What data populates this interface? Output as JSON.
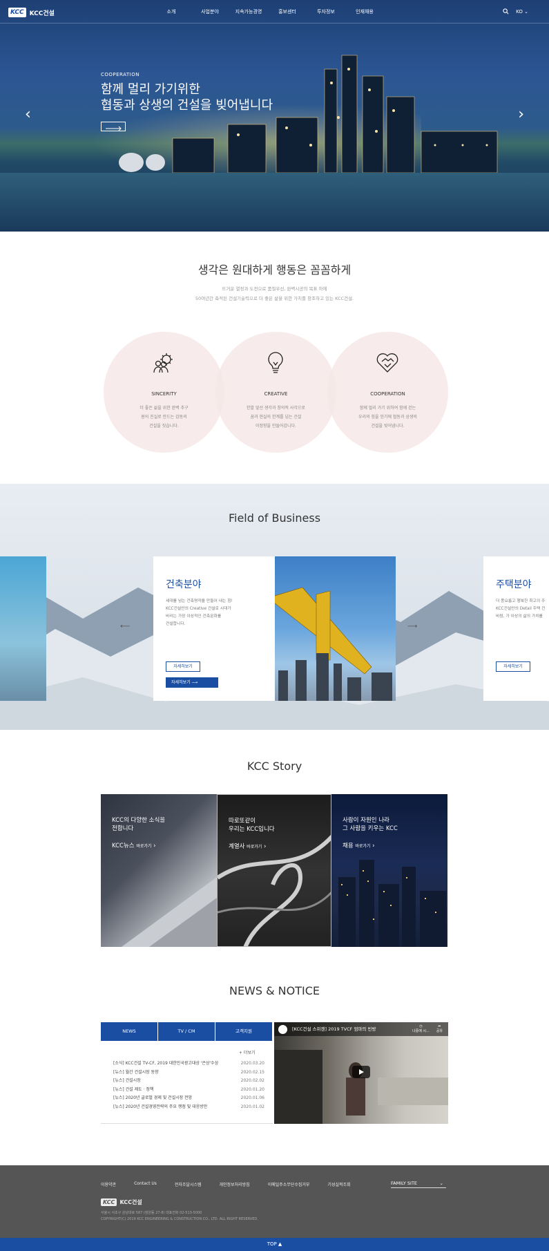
{
  "header": {
    "logo_mark": "KCC",
    "logo_text": "KCC건설",
    "nav": [
      "소개",
      "사업분야",
      "지속가능경영",
      "홍보센터",
      "투자정보",
      "인재채용"
    ],
    "lang": "KO"
  },
  "hero": {
    "eyebrow": "COOPERATION",
    "line1": "함께 멀리 가기위한",
    "line2": "협동과 상생의 건설을 빚어냅니다"
  },
  "intro": {
    "title": "생각은 원대하게 행동은 꼼꼼하게",
    "sub1": "뜨거운 열정과 도전으로 품질우선, 완벽시공의 목표 하에",
    "sub2": "50여년간 축적된 건설기술력으로 더 좋은 삶을 위한 가치를 창조하고 있는 KCC건설.",
    "values": [
      {
        "title": "SINCERITY",
        "d1": "더 좋은 삶을 위한 완벽 추구",
        "d2": "원의 진실로 만드는 감동의",
        "d3": "건설을 짓습니다."
      },
      {
        "title": "CREATIVE",
        "d1": "한발 앞선 생각과 창의적 사각으로",
        "d2": "꿈과 현실의 한계를 넘는 건설",
        "d3": "이정향을 만들어갑니다."
      },
      {
        "title": "COOPERATION",
        "d1": "함께 멀리 가기 위하여 함께 걷는",
        "d2": "우리의 힘을 믿기에 협동과 상생의",
        "d3": "건설을 빚어냅니다."
      }
    ]
  },
  "business": {
    "title": "Field of Business",
    "card1": {
      "title": "건축분야",
      "d1": "세대를 넘는 건축명작을 만들어 내는 힘!",
      "d2": "KCC건설만의 Creative 건설로 시대가",
      "d3": "바라는 가장 이상적인 건축문화를",
      "d4": "건설합니다.",
      "btn1": "자세히보기",
      "btn2": "자세히보기"
    },
    "card2": {
      "title": "주택분야",
      "d1": "더 풍요롭고 행복한 최고의 주",
      "d2": "KCC건설만의 Detail 주택 건",
      "d3": "바람, 가 이상의 삶의 가치를",
      "btn1": "자세히보기"
    }
  },
  "story": {
    "title": "KCC Story",
    "tiles": [
      {
        "t1": "KCC의 다양한 소식을",
        "t2": "전합니다",
        "link": "KCC뉴스",
        "small": "바로가기"
      },
      {
        "t1": "따로또같이",
        "t2": "우리는 KCC입니다",
        "link": "계열사",
        "small": "바로가기"
      },
      {
        "t1": "사람이 자원인 나라",
        "t2": "그 사람을 키우는 KCC",
        "link": "채용",
        "small": "바로가기"
      }
    ]
  },
  "news": {
    "title": "NEWS & NOTICE",
    "tabs": [
      "NEWS",
      "TV / CM",
      "고객지원"
    ],
    "more": "+ 더보기",
    "items": [
      {
        "t": "[소식] KCC건설 TV-CF, 2019 대한민국광고대상 '은상'수상",
        "d": "2020.03.20"
      },
      {
        "t": "[뉴스] 월간 건설시장 동향",
        "d": "2020.02.15"
      },
      {
        "t": "[뉴스] 건설시장",
        "d": "2020.02.02"
      },
      {
        "t": "[뉴스] 건설 제도 · 정책",
        "d": "2020.01.20"
      },
      {
        "t": "[뉴스] 2020년 글로벌 경제 및 건설시장 전망",
        "d": "2020.01.06"
      },
      {
        "t": "[뉴스] 2020년 건설경영전략의 주요 쟁점 및 대응방안",
        "d": "2020.01.02"
      }
    ],
    "video_title": "[KCC건설 스위첸] 2019 TVCF 엄마의 빈방",
    "video_later": "나중에 시...",
    "video_share": "공유"
  },
  "footer": {
    "links": [
      "이용약관",
      "Contact Us",
      "전자조달시스템",
      "개인정보처리방침",
      "이메일주소무단수집거부",
      "기성실적조회"
    ],
    "family": "FAMILY SITE",
    "logo_mark": "KCC",
    "logo_text": "KCC건설",
    "addr": "서울시 서초구 강남대로 587 (잠원동 27-8) 대표전화 02-513-5000",
    "copy": "COPYRIGHT(C) 2019 KCC ENGINEERING & CONSTRUCTION CO., LTD. ALL RIGHT RESERVED.",
    "top": "TOP ▲"
  }
}
